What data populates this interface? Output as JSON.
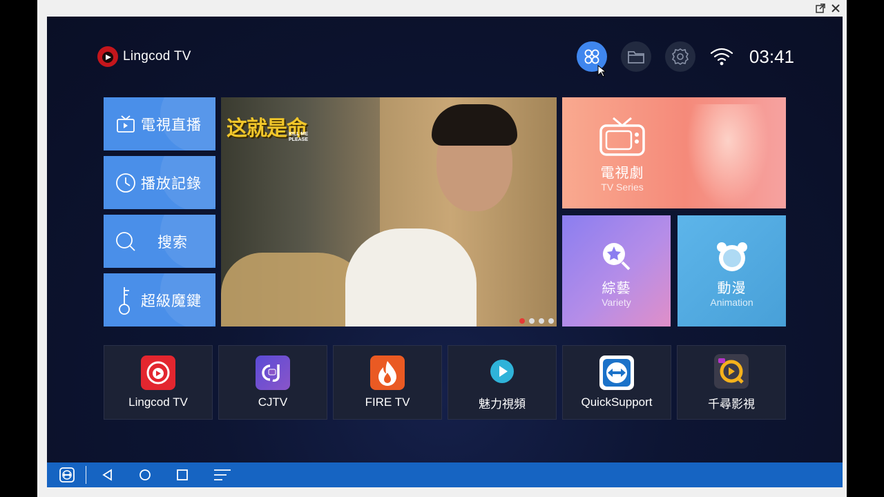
{
  "brand": {
    "name": "Lingcod TV",
    "accent": "#c4161c"
  },
  "status": {
    "time": "03:41"
  },
  "topbar": {
    "icons": [
      "apps-icon",
      "folder-icon",
      "settings-icon",
      "wifi-icon"
    ]
  },
  "left_menu": [
    {
      "label": "電視直播",
      "icon": "tv-icon"
    },
    {
      "label": "播放記錄",
      "icon": "clock-icon"
    },
    {
      "label": "搜索",
      "icon": "search-icon"
    },
    {
      "label": "超級魔鍵",
      "icon": "key-icon"
    }
  ],
  "banner": {
    "title": "这就是命",
    "subtitle": "KILL ME PLEASE",
    "slide_count": 4,
    "active_slide": 1
  },
  "categories": {
    "tv": {
      "zh": "電視劇",
      "en": "TV Series"
    },
    "variety": {
      "zh": "綜藝",
      "en": "Variety"
    },
    "anime": {
      "zh": "動漫",
      "en": "Animation"
    }
  },
  "apps": [
    {
      "name": "Lingcod TV",
      "color": "#e3262f"
    },
    {
      "name": "CJTV",
      "color": "#6a4fc9"
    },
    {
      "name": "FIRE TV",
      "color": "#ea5a23"
    },
    {
      "name": "魅力視頻",
      "color": "#2fb3d9"
    },
    {
      "name": "QuickSupport",
      "color": "#1b72c9"
    },
    {
      "name": "千尋影視",
      "color": "#3b3b4a"
    }
  ],
  "colors": {
    "tile_blue": "#4a8fe9",
    "navbar": "#1664c2",
    "active_button": "#3f86ee"
  }
}
